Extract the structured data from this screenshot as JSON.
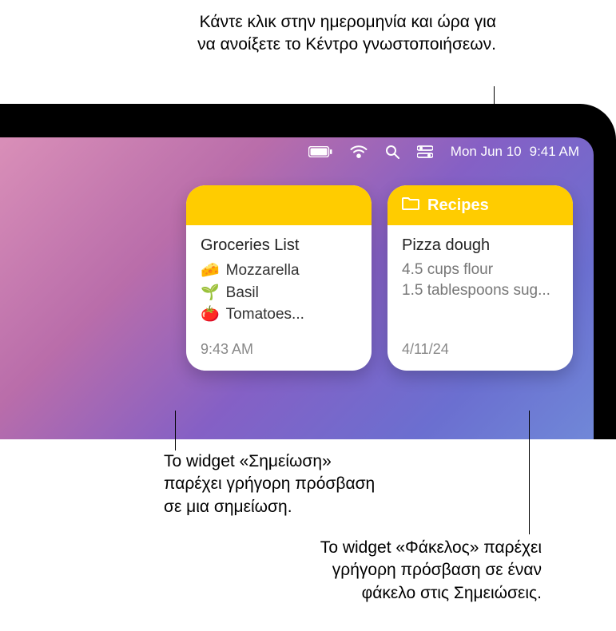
{
  "callouts": {
    "top": "Κάντε κλικ στην ημερομηνία και ώρα για να ανοίξετε το Κέντρο γνωστοποιήσεων.",
    "left": "Το widget «Σημείωση» παρέχει γρήγορη πρόσβαση σε μια σημείωση.",
    "right": "Το widget «Φάκελος» παρέχει γρήγορη πρόσβαση σε έναν φάκελο στις Σημειώσεις."
  },
  "menubar": {
    "date": "Mon Jun 10",
    "time": "9:41 AM"
  },
  "widgets": {
    "note": {
      "title": "Groceries List",
      "items": [
        {
          "emoji": "🧀",
          "text": "Mozzarella"
        },
        {
          "emoji": "🌱",
          "text": "Basil"
        },
        {
          "emoji": "🍅",
          "text": "Tomatoes..."
        }
      ],
      "timestamp": "9:43 AM"
    },
    "folder": {
      "header": "Recipes",
      "title": "Pizza dough",
      "line1": "4.5 cups flour",
      "line2": "1.5 tablespoons sug...",
      "timestamp": "4/11/24"
    }
  }
}
